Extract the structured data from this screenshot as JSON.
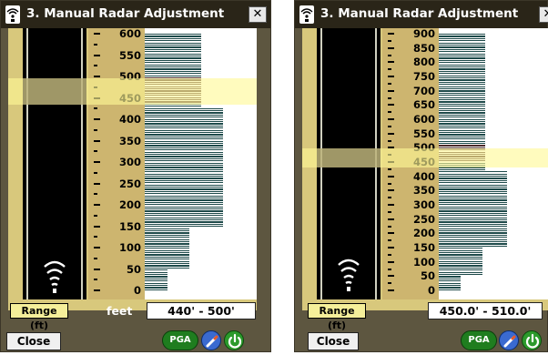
{
  "windows": [
    {
      "title": "3. Manual Radar Adjustment",
      "close_glyph": "✕",
      "ticks": [
        "600",
        "550",
        "500",
        "450",
        "400",
        "350",
        "300",
        "250",
        "200",
        "150",
        "100",
        "50",
        "0"
      ],
      "range_label": "Range (ft)",
      "unit_label": "feet",
      "range_value": "440' -   500'",
      "close_button": "Close",
      "pga_label": "PGA",
      "scale_max_ft": 600,
      "selected_range_ft": [
        440,
        500
      ],
      "signal_profile": [
        {
          "from_ft": 0,
          "to_ft": 50,
          "level": 0.2
        },
        {
          "from_ft": 50,
          "to_ft": 150,
          "level": 0.4
        },
        {
          "from_ft": 150,
          "to_ft": 430,
          "level": 0.7
        },
        {
          "from_ft": 430,
          "to_ft": 600,
          "level": 0.5
        }
      ],
      "colors": {
        "bar": "#1e4a4a",
        "bar_selected": "#4a2a2a"
      }
    },
    {
      "title": "3. Manual Radar Adjustment",
      "close_glyph": "✕",
      "ticks": [
        "900",
        "850",
        "800",
        "750",
        "700",
        "650",
        "600",
        "550",
        "500",
        "450",
        "400",
        "350",
        "300",
        "250",
        "200",
        "150",
        "100",
        "50",
        "0"
      ],
      "range_label": "Range (ft)",
      "unit_label": "feet",
      "range_value": "450.0' -  510.0'",
      "close_button": "Close",
      "pga_label": "PGA",
      "scale_max_ft": 900,
      "selected_range_ft": [
        450,
        510
      ],
      "signal_profile": [
        {
          "from_ft": 0,
          "to_ft": 50,
          "level": 0.2
        },
        {
          "from_ft": 50,
          "to_ft": 150,
          "level": 0.4
        },
        {
          "from_ft": 150,
          "to_ft": 420,
          "level": 0.62
        },
        {
          "from_ft": 420,
          "to_ft": 900,
          "level": 0.42
        }
      ],
      "colors": {
        "bar": "#1e4a4a",
        "bar_selected": "#4a2a2a"
      }
    }
  ]
}
